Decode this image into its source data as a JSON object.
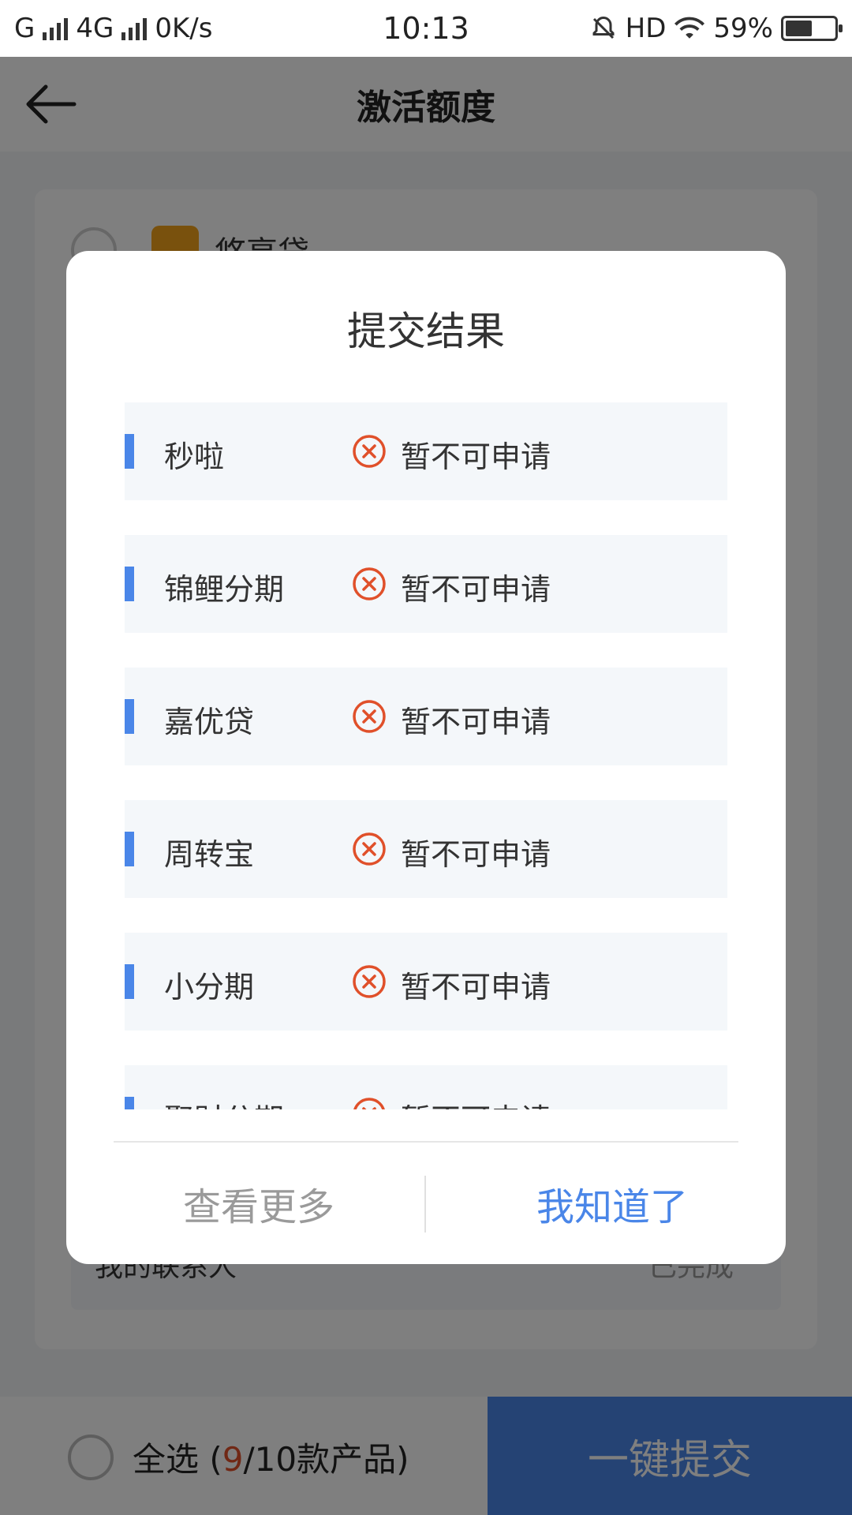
{
  "status_bar": {
    "left_text_1": "G",
    "left_text_2": "4G",
    "speed": "0K/s",
    "time": "10:13",
    "hd": "HD",
    "battery_percent_text": "59%",
    "battery_level": 0.59
  },
  "header": {
    "title": "激活额度"
  },
  "background": {
    "product_name": "悠享贷",
    "row_left": "我的联系人",
    "row_right": "已完成"
  },
  "bottom_bar": {
    "select_all_label": "全选 (",
    "selected_count": "9",
    "total_suffix": "/10款产品)",
    "submit_label": "一键提交"
  },
  "dialog": {
    "title": "提交结果",
    "items": [
      {
        "name": "秒啦",
        "status": "暂不可申请"
      },
      {
        "name": "锦鲤分期",
        "status": "暂不可申请"
      },
      {
        "name": "嘉优贷",
        "status": "暂不可申请"
      },
      {
        "name": "周转宝",
        "status": "暂不可申请"
      },
      {
        "name": "小分期",
        "status": "暂不可申请"
      },
      {
        "name": "聚财分期",
        "status": "暂不可申请"
      }
    ],
    "more_label": "查看更多",
    "ok_label": "我知道了"
  },
  "colors": {
    "accent": "#4a86e8",
    "error": "#e0502a"
  }
}
